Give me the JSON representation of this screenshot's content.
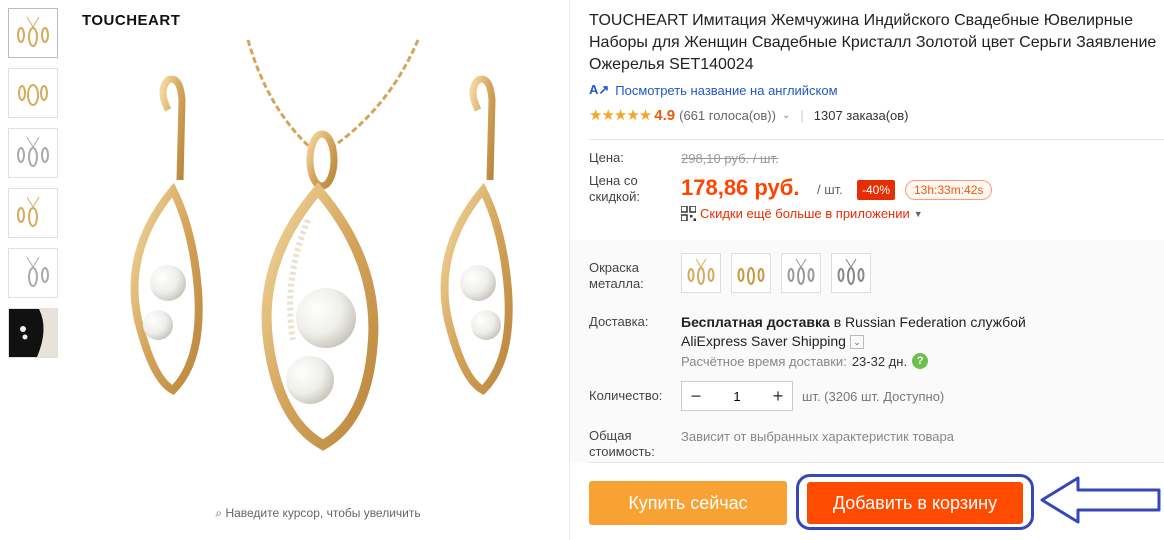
{
  "thumbnails": {
    "icons": [
      "jewelry-set-gold-1",
      "jewelry-set-gold-2",
      "jewelry-set-silver-1",
      "jewelry-set-gold-3",
      "jewelry-set-silver-2",
      "jewelry-on-model"
    ]
  },
  "main_image": {
    "brand": "TOUCHEART",
    "zoom_hint": "Наведите курсор, чтобы увеличить"
  },
  "product": {
    "title": "TOUCHEART Имитация Жемчужина Индийского Свадебные Ювелирные\nНаборы для Женщин Свадебные Кристалл Золотой цвет Серьги Заявление\nОжерелья SET140024",
    "translate_link": "Посмотреть название на английском",
    "stars": "★★★★★",
    "rating": "4.9",
    "votes": "(661 голоса(ов))",
    "orders": "1307 заказа(ов)"
  },
  "price": {
    "price_label": "Цена:",
    "old_price": "298,10 руб. / шт.",
    "discount_label": "Цена со\nскидкой:",
    "new_price": "178,86 руб.",
    "unit": "/ шт.",
    "discount_badge": "-40%",
    "timer": "13h:33m:42s",
    "app_discount": "Скидки ещё больше в приложении"
  },
  "options": {
    "color_label": "Окраска\nметалла:",
    "swatch_count": 4
  },
  "shipping": {
    "label": "Доставка:",
    "prefix": "Бесплатная доставка",
    "middle": " в Russian Federation службой",
    "service": "AliExpress Saver Shipping",
    "eta_label": "Расчётное время доставки:",
    "eta_days": "23-32 дн."
  },
  "quantity": {
    "label": "Количество:",
    "value": "1",
    "minus": "−",
    "plus": "+",
    "available": "шт. (3206 шт. Доступно)"
  },
  "total": {
    "label": "Общая\nстоимость:",
    "note": "Зависит от выбранных характеристик товара"
  },
  "actions": {
    "buy_now": "Купить сейчас",
    "add_to_cart": "Добавить в корзину"
  },
  "colors": {
    "accent": "#ff4400",
    "buy": "#f7a232",
    "cart": "#ff4b00",
    "link": "#2158c7",
    "annotation": "#3647b8"
  }
}
